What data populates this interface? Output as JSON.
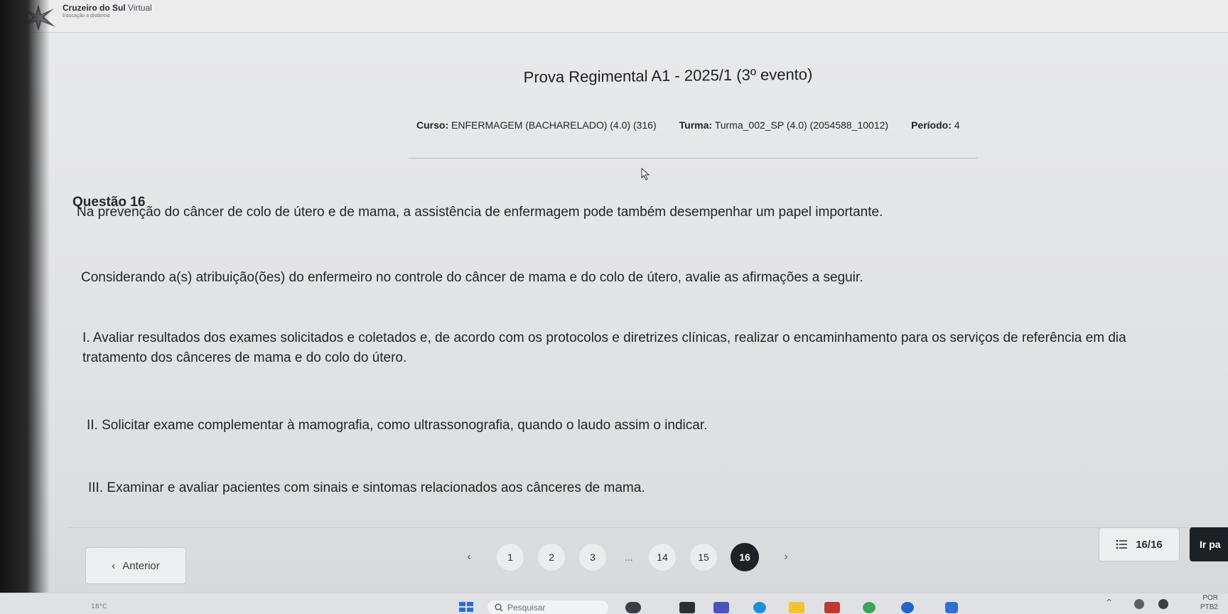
{
  "header": {
    "brand_name": "Cruzeiro do Sul",
    "brand_suffix": "Virtual",
    "brand_tagline": "Educação a distância"
  },
  "exam": {
    "title": "Prova Regimental A1 - 2025/1 (3º evento)",
    "course_label": "Curso:",
    "course_value": "ENFERMAGEM (BACHARELADO) (4.0) (316)",
    "class_label": "Turma:",
    "class_value": "Turma_002_SP (4.0) (2054588_10012)",
    "period_label": "Período:",
    "period_value": "4"
  },
  "question": {
    "title": "Questão 16",
    "intro": "Na prevenção do câncer de colo de útero e de mama, a assistência de enfermagem pode também desempenhar um papel importante.",
    "prompt": "Considerando a(s) atribuição(ões) do enfermeiro no controle do câncer de mama e do colo de útero, avalie as afirmações a seguir.",
    "statement_1_line_1": "I. Avaliar resultados dos exames solicitados e coletados e, de acordo com os protocolos e diretrizes clínicas, realizar o encaminhamento para os serviços de referência em dia",
    "statement_1_line_2": "tratamento dos cânceres de mama e do colo do útero.",
    "statement_2": "II. Solicitar exame complementar à mamografia, como ultrassonografia, quando o laudo assim o indicar.",
    "statement_3": "III. Examinar e avaliar pacientes com sinais e sintomas relacionados aos cânceres de mama."
  },
  "navigation": {
    "prev_arrow": "‹",
    "prev_label": "Anterior",
    "pager_prev": "‹",
    "pages": [
      "1",
      "2",
      "3",
      "...",
      "14",
      "15",
      "16"
    ],
    "active_page": "16",
    "pager_next": "›",
    "counter": "16/16",
    "go_label": "Ir pa"
  },
  "taskbar": {
    "weather": "18°C",
    "search_placeholder": "Pesquisar",
    "lang": "POR",
    "layout": "PTB2"
  },
  "icons": {
    "logo": "star-logo-icon",
    "cursor": "mouse-pointer-icon",
    "list": "list-icon",
    "search": "search-icon",
    "start": "windows-start-icon"
  },
  "colors": {
    "active_page": "#1d2227",
    "go_button": "#1c2126",
    "start_blue": "#2d6cd6"
  }
}
